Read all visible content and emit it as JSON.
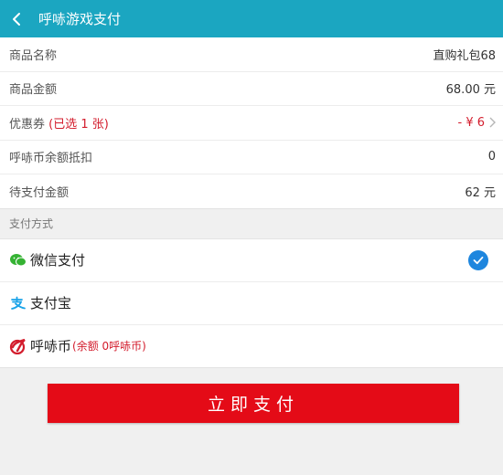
{
  "header": {
    "title": "呼哧游戏支付",
    "back_icon": "chevron-left-icon"
  },
  "order": {
    "product_name_label": "商品名称",
    "product_name_value": "直购礼包68",
    "amount_label": "商品金额",
    "amount_value": "68.00 元",
    "coupon_label": "优惠券",
    "coupon_selected": "(已选 1 张)",
    "coupon_value": "- ¥ 6",
    "huchi_label": "呼哧币余额抵扣",
    "huchi_value": "0",
    "due_label": "待支付金额",
    "due_value": "62 元"
  },
  "payment": {
    "section_title": "支付方式",
    "methods": [
      {
        "label": "微信支付",
        "icon": "wechat-icon",
        "selected": true
      },
      {
        "label": "支付宝",
        "icon": "alipay-icon",
        "selected": false
      },
      {
        "label": "呼哧币",
        "sub": "(余额 0呼哧币)",
        "icon": "huchi-icon",
        "selected": false
      }
    ]
  },
  "submit_label": "立即支付",
  "colors": {
    "topbar": "#1ba6c1",
    "accent_red": "#d31c2c",
    "button": "#e40b17",
    "check": "#1e86de",
    "wechat": "#35b233",
    "alipay": "#1aa3e8"
  }
}
